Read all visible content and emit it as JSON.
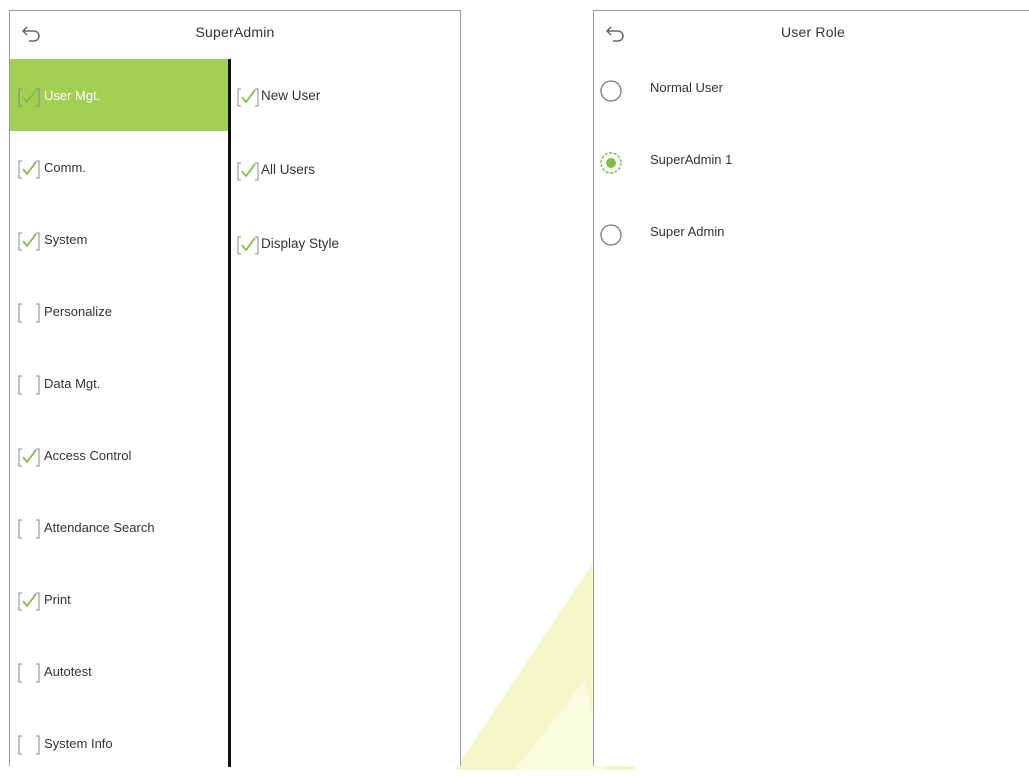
{
  "left_panel": {
    "title": "SuperAdmin",
    "menu": [
      {
        "label": "User Mgt.",
        "checked": true,
        "selected": true
      },
      {
        "label": "Comm.",
        "checked": true,
        "selected": false
      },
      {
        "label": "System",
        "checked": true,
        "selected": false
      },
      {
        "label": "Personalize",
        "checked": false,
        "selected": false
      },
      {
        "label": "Data Mgt.",
        "checked": false,
        "selected": false
      },
      {
        "label": "Access Control",
        "checked": true,
        "selected": false
      },
      {
        "label": "Attendance Search",
        "checked": false,
        "selected": false
      },
      {
        "label": "Print",
        "checked": true,
        "selected": false
      },
      {
        "label": "Autotest",
        "checked": false,
        "selected": false
      },
      {
        "label": "System Info",
        "checked": false,
        "selected": false
      }
    ],
    "submenu": [
      {
        "label": "New User",
        "checked": true
      },
      {
        "label": "All Users",
        "checked": true
      },
      {
        "label": "Display Style",
        "checked": true
      }
    ]
  },
  "right_panel": {
    "title": "User Role",
    "options": [
      {
        "label": "Normal User",
        "selected": false
      },
      {
        "label": "SuperAdmin 1",
        "selected": true
      },
      {
        "label": "Super Admin",
        "selected": false
      }
    ]
  },
  "colors": {
    "accent": "#a1cf52",
    "check": "#7cc142",
    "border": "#9a9a9a",
    "watermark": "#f5f7c8"
  },
  "icons": {
    "back": "back-arrow-icon",
    "checked": "checkbox-checked-icon",
    "unchecked": "checkbox-unchecked-icon"
  }
}
